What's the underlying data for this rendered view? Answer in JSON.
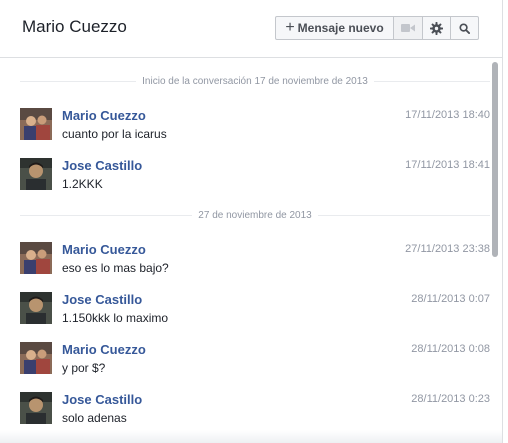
{
  "header": {
    "title": "Mario Cuezzo",
    "new_message_label": "Mensaje nuevo"
  },
  "conversation": {
    "start_label": "Inicio de la conversación 17 de noviembre de 2013",
    "date_separator": "27 de noviembre de 2013",
    "messages": [
      {
        "sender": "Mario Cuezzo",
        "time": "17/11/2013 18:40",
        "text": "cuanto por la icarus"
      },
      {
        "sender": "Jose Castillo",
        "time": "17/11/2013 18:41",
        "text": "1.2KKK"
      },
      {
        "sender": "Mario Cuezzo",
        "time": "27/11/2013 23:38",
        "text": "eso es lo mas bajo?"
      },
      {
        "sender": "Jose Castillo",
        "time": "28/11/2013 0:07",
        "text": "1.150kkk lo maximo"
      },
      {
        "sender": "Mario Cuezzo",
        "time": "28/11/2013 0:08",
        "text": "y por $?"
      },
      {
        "sender": "Jose Castillo",
        "time": "28/11/2013 0:23",
        "text": "solo adenas"
      }
    ]
  },
  "icons": [
    "plus-icon",
    "video-camera-icon",
    "gear-icon",
    "search-icon"
  ],
  "colors": {
    "sender_name": "#365899",
    "meta_text": "#9197a3",
    "border": "#dddfe2"
  }
}
